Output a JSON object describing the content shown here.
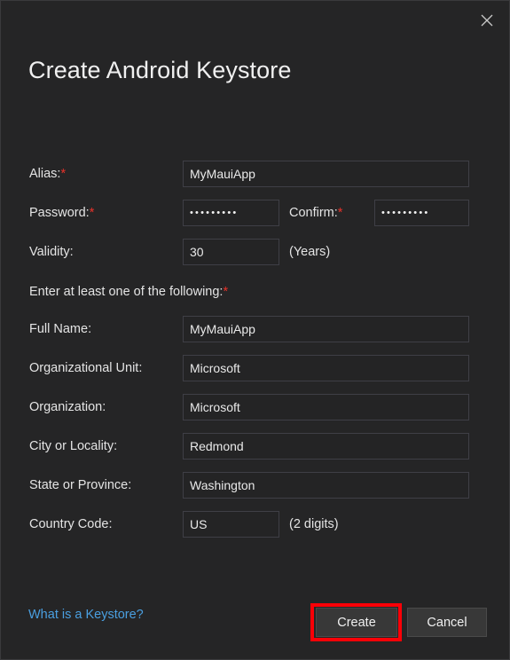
{
  "window": {
    "title": "Create Android Keystore",
    "close_icon": "close-icon",
    "background_color": "#252526",
    "accent_required_color": "#e8322a",
    "link_color": "#4a9fe0",
    "highlight_color": "#fb0007"
  },
  "form": {
    "rows": [
      {
        "label": "Alias:",
        "required": true,
        "value": "MyMauiApp",
        "field_width": "wide",
        "suffix": ""
      },
      {
        "label": "Password:",
        "required": true,
        "value": "•••••••••",
        "field_width": "short",
        "suffix": ""
      },
      {
        "label": "Validity:",
        "required": false,
        "value": "30",
        "field_width": "short",
        "suffix": "(Years)"
      }
    ],
    "confirm": {
      "label": "Confirm:",
      "required": true,
      "value": "•••••••••"
    },
    "section_note": "Enter at least one of the following:",
    "section_note_required": true,
    "detail_rows": [
      {
        "label": "Full Name:",
        "value": "MyMauiApp",
        "field_width": "wide",
        "suffix": ""
      },
      {
        "label": "Organizational Unit:",
        "value": "Microsoft",
        "field_width": "wide",
        "suffix": ""
      },
      {
        "label": "Organization:",
        "value": "Microsoft",
        "field_width": "wide",
        "suffix": ""
      },
      {
        "label": "City or Locality:",
        "value": "Redmond",
        "field_width": "wide",
        "suffix": ""
      },
      {
        "label": "State or Province:",
        "value": "Washington",
        "field_width": "wide",
        "suffix": ""
      },
      {
        "label": "Country Code:",
        "value": "US",
        "field_width": "short",
        "suffix": "(2 digits)"
      }
    ]
  },
  "footer": {
    "help_link": "What is a Keystore?",
    "create_label": "Create",
    "cancel_label": "Cancel"
  }
}
